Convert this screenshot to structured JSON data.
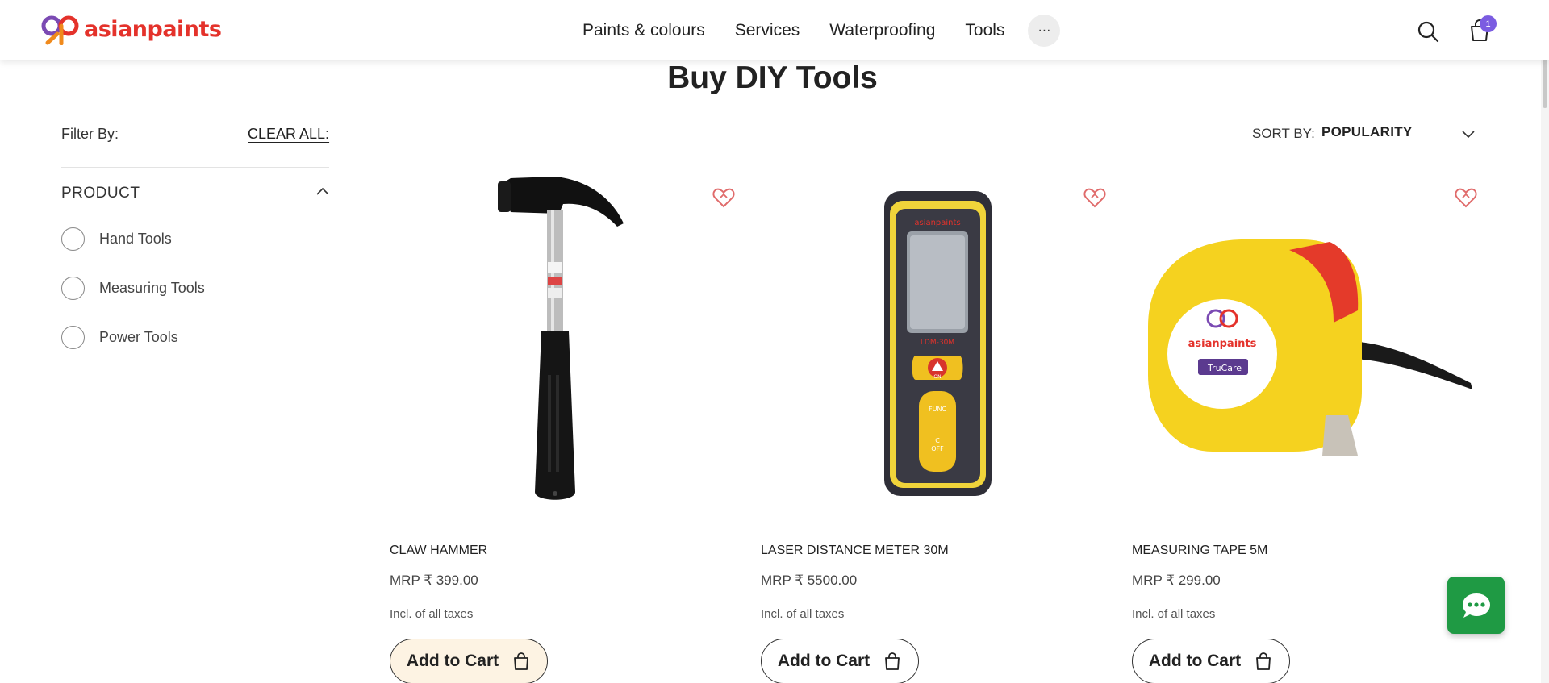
{
  "brand": {
    "name": "asianpaints"
  },
  "nav": {
    "items": [
      "Paints & colours",
      "Services",
      "Waterproofing",
      "Tools"
    ],
    "more": "···"
  },
  "cart": {
    "badge": "1"
  },
  "page": {
    "title": "Buy DIY Tools"
  },
  "filters": {
    "label": "Filter By:",
    "clear_all": "CLEAR ALL:",
    "section": "PRODUCT",
    "options": [
      {
        "label": "Hand Tools",
        "selected": false
      },
      {
        "label": "Measuring Tools",
        "selected": false
      },
      {
        "label": "Power Tools",
        "selected": false
      }
    ]
  },
  "sort": {
    "label": "SORT BY:",
    "value": "POPULARITY"
  },
  "products": [
    {
      "name": "CLAW HAMMER",
      "price": "MRP ₹ 399.00",
      "tax": "Incl. of all taxes",
      "button": "Add to Cart",
      "image": "claw-hammer"
    },
    {
      "name": "LASER DISTANCE METER 30M",
      "price": "MRP ₹ 5500.00",
      "tax": "Incl. of all taxes",
      "button": "Add to Cart",
      "image": "laser-distance-meter"
    },
    {
      "name": "MEASURING TAPE 5M",
      "price": "MRP ₹ 299.00",
      "tax": "Incl. of all taxes",
      "button": "Add to Cart",
      "image": "measuring-tape"
    }
  ],
  "product_art": {
    "meter_brand": "asianpaints",
    "meter_model": "LDM-30M",
    "meter_on": "ON",
    "meter_func": "FUNC",
    "meter_c": "C",
    "meter_off": "OFF",
    "tape_brand": "asianpaints",
    "tape_sub": "TruCare"
  },
  "colors": {
    "brand_red": "#e4322b",
    "badge": "#7b5ce1",
    "chat": "#1f9a44",
    "wishlist": "#e06b6b",
    "active_button": "#fdf3e3"
  }
}
